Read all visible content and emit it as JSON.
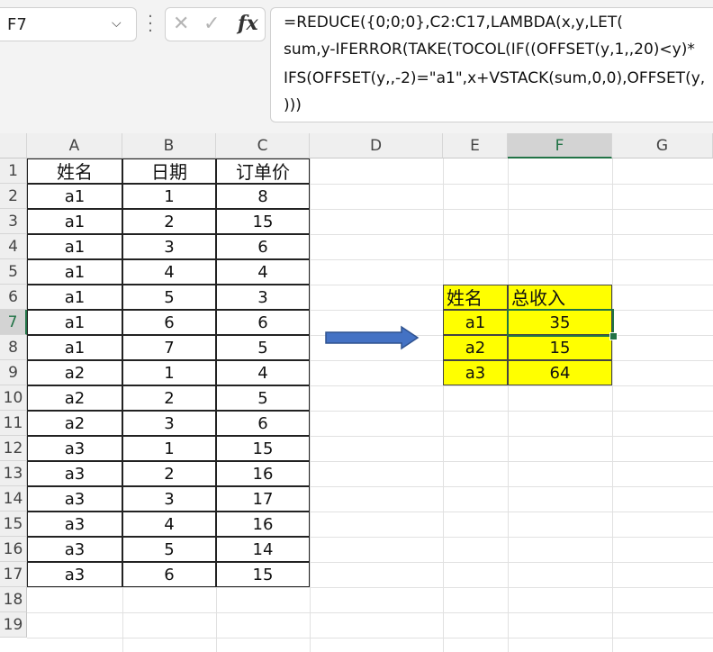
{
  "name_box": {
    "value": "F7"
  },
  "formula_bar": {
    "lines": [
      "=REDUCE({0;0;0},C2:C17,LAMBDA(x,y,LET(",
      "sum,y-IFERROR(TAKE(TOCOL(IF((OFFSET(y,1,,20)<y)*",
      "IFS(OFFSET(y,,-2)=\"a1\",x+VSTACK(sum,0,0),OFFSET(y,",
      ")))"
    ]
  },
  "columns": [
    "A",
    "B",
    "C",
    "D",
    "E",
    "F",
    "G"
  ],
  "rows": [
    "1",
    "2",
    "3",
    "4",
    "5",
    "6",
    "7",
    "8",
    "9",
    "10",
    "11",
    "12",
    "13",
    "14",
    "15",
    "16",
    "17",
    "18",
    "19"
  ],
  "table": {
    "headers": [
      "姓名",
      "日期",
      "订单价"
    ],
    "rows": [
      [
        "a1",
        "1",
        "8"
      ],
      [
        "a1",
        "2",
        "15"
      ],
      [
        "a1",
        "3",
        "6"
      ],
      [
        "a1",
        "4",
        "4"
      ],
      [
        "a1",
        "5",
        "3"
      ],
      [
        "a1",
        "6",
        "6"
      ],
      [
        "a1",
        "7",
        "5"
      ],
      [
        "a2",
        "1",
        "4"
      ],
      [
        "a2",
        "2",
        "5"
      ],
      [
        "a2",
        "3",
        "6"
      ],
      [
        "a3",
        "1",
        "15"
      ],
      [
        "a3",
        "2",
        "16"
      ],
      [
        "a3",
        "3",
        "17"
      ],
      [
        "a3",
        "4",
        "16"
      ],
      [
        "a3",
        "5",
        "14"
      ],
      [
        "a3",
        "6",
        "15"
      ]
    ]
  },
  "summary": {
    "headers": [
      "姓名",
      "总收入"
    ],
    "rows": [
      [
        "a1",
        "35"
      ],
      [
        "a2",
        "15"
      ],
      [
        "a3",
        "64"
      ]
    ]
  },
  "colors": {
    "highlight": "#ffff00",
    "selection": "#217346",
    "arrow_fill": "#4472c4",
    "arrow_stroke": "#2f528f"
  },
  "icons": [
    "chevron-down-icon",
    "more-options-icon",
    "cancel-icon",
    "enter-icon",
    "insert-function-icon",
    "arrow-right-icon"
  ]
}
